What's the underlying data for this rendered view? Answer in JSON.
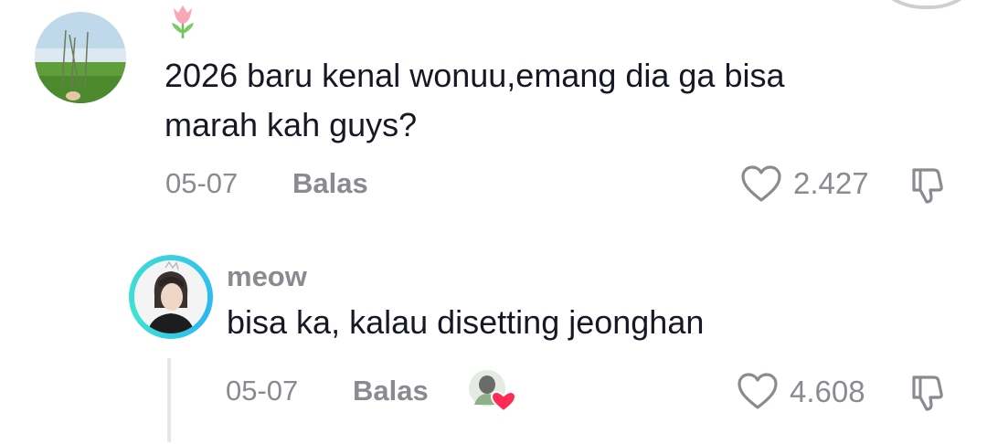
{
  "comment": {
    "text": "2026 baru kenal wonuu,emang dia ga bisa\nmarah kah guys?",
    "date": "05-07",
    "reply_label": "Balas",
    "like_count": "2.427",
    "badge_icon": "tulip-icon",
    "avatar_icon": "grass-field-avatar"
  },
  "reply": {
    "username": "meow",
    "text": "bisa ka, kalau disetting jeonghan",
    "date": "05-07",
    "reply_label": "Balas",
    "like_count": "4.608",
    "avatar_icon": "portrait-avatar",
    "liked_by_creator_icon": "creator-liked-heart-avatar"
  },
  "colors": {
    "text_primary": "#161823",
    "text_secondary": "#8a8b91",
    "ring_accent": "#2ab7f3",
    "heart_badge": "#fe2c55"
  }
}
